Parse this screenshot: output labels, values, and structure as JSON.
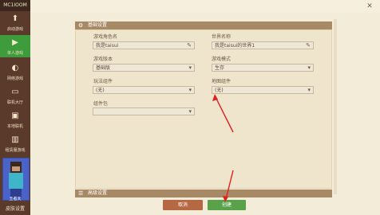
{
  "app": {
    "title": "MC1IOOM"
  },
  "sidebar": {
    "items": [
      {
        "label": "启动游戏",
        "icon": "rocket-icon"
      },
      {
        "label": "单人游戏",
        "icon": "play-icon"
      },
      {
        "label": "网络游戏",
        "icon": "globe-icon"
      },
      {
        "label": "联机大厅",
        "icon": "chat-icon"
      },
      {
        "label": "本地联机",
        "icon": "monitor-icon"
      },
      {
        "label": "租赁服游戏",
        "icon": "server-icon"
      }
    ],
    "skin": "皮肤设置",
    "avatar_caption": "王者天"
  },
  "panel": {
    "header": "基础设置",
    "fields": {
      "game_name_label": "游戏角色名",
      "game_name_value": "我是taisui",
      "world_name_label": "世界名称",
      "world_name_value": "我是taisui的世界1",
      "version_label": "游戏版本",
      "version_value": "基础版",
      "mode_label": "游戏模式",
      "mode_value": "生存",
      "play_component_label": "玩法组件",
      "play_component_value": "(无)",
      "map_component_label": "地图组件",
      "map_component_value": "(无)",
      "component_pack_label": "组件包",
      "component_pack_value": ""
    }
  },
  "advanced": {
    "header": "高级设置"
  },
  "buttons": {
    "cancel": "取消",
    "create": "创建"
  },
  "colors": {
    "sidebar_bg": "#5a3a2a",
    "active_nav": "#3f9c3c",
    "panel_header": "#a78a65",
    "cancel_button": "#b66843",
    "create_button": "#5aa24a",
    "annotation_arrow": "#e02020"
  }
}
